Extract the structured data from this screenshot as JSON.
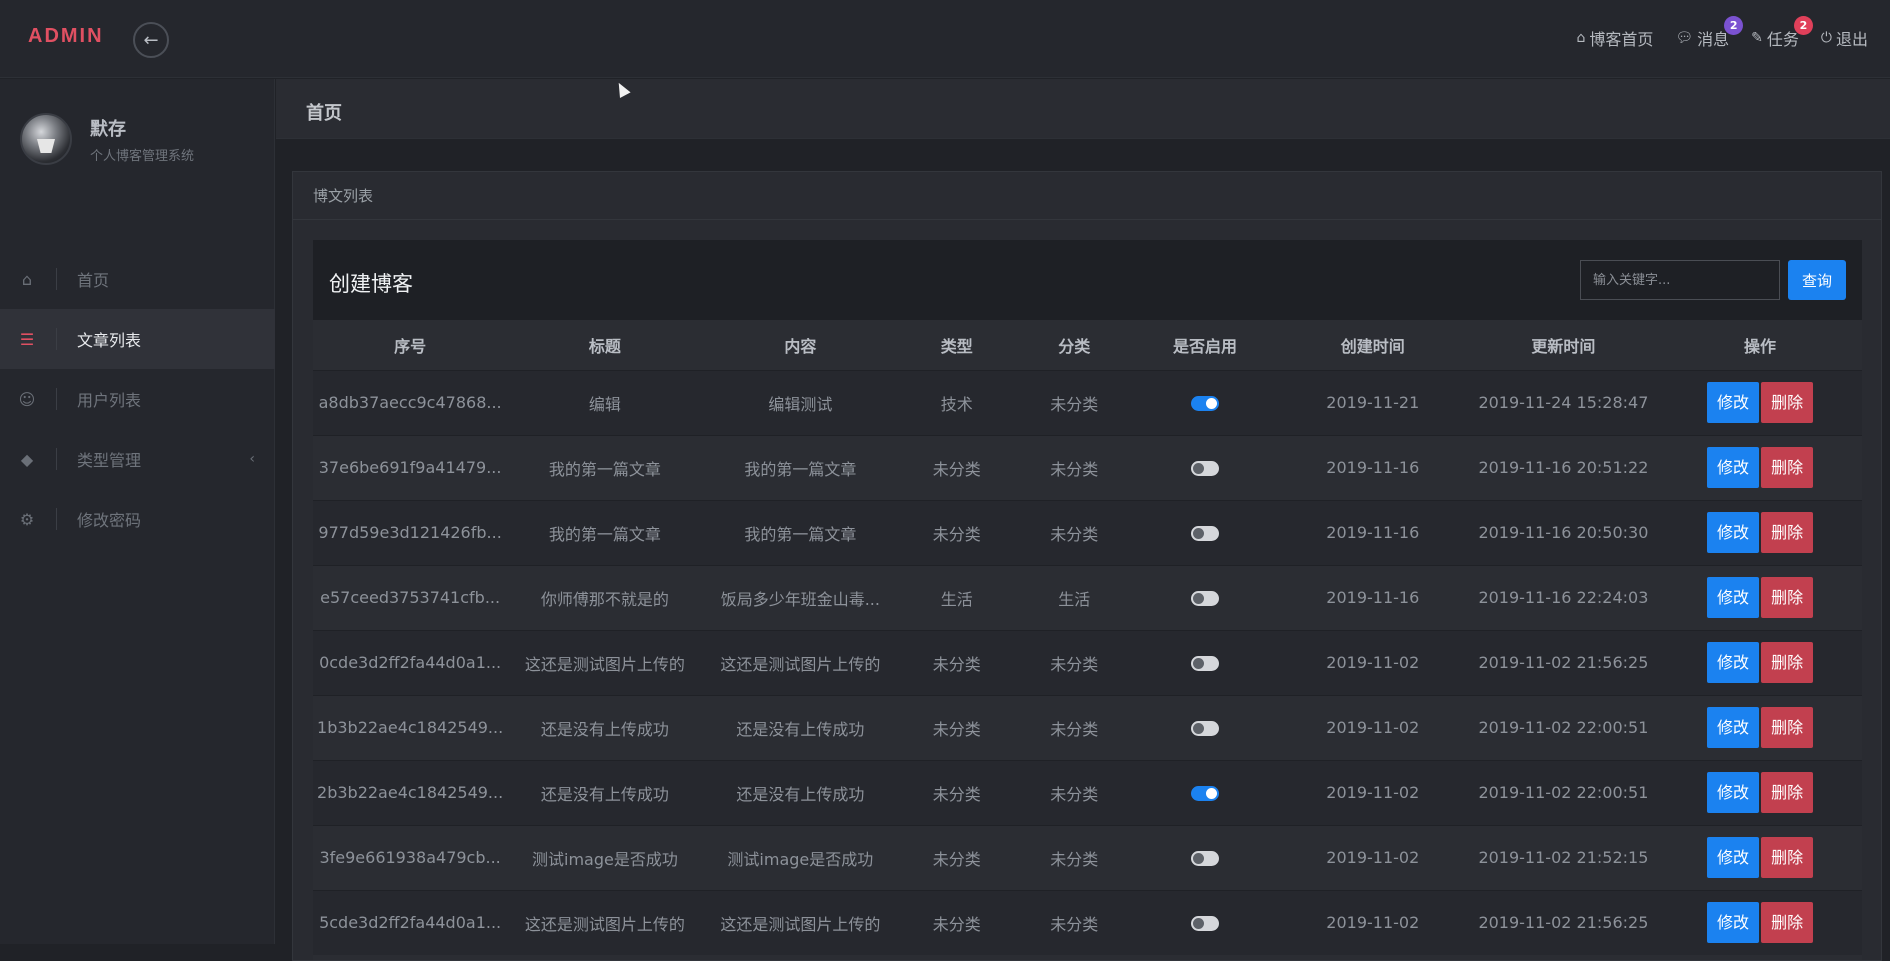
{
  "topbar": {
    "brand": "ADMIN",
    "collapse_icon": "arrow-left-icon",
    "nav": [
      {
        "icon": "home-icon",
        "label": "博客首页"
      },
      {
        "icon": "comment-icon",
        "label": "消息",
        "badge": "2",
        "badge_color": "#7b52d1"
      },
      {
        "icon": "edit-icon",
        "label": "任务",
        "badge": "2",
        "badge_color": "#e0405a"
      },
      {
        "icon": "power-icon",
        "label": "退出"
      }
    ]
  },
  "sidebar": {
    "profile": {
      "name": "默存",
      "subtitle": "个人博客管理系统"
    },
    "items": [
      {
        "icon": "home-icon",
        "label": "首页"
      },
      {
        "icon": "list-icon",
        "label": "文章列表",
        "active": true
      },
      {
        "icon": "users-icon",
        "label": "用户列表"
      },
      {
        "icon": "tags-icon",
        "label": "类型管理",
        "has_arrow": true
      },
      {
        "icon": "gear-icon",
        "label": "修改密码"
      }
    ]
  },
  "page": {
    "title": "首页",
    "card_title": "博文列表",
    "panel_title": "创建博客",
    "search_placeholder": "输入关键字...",
    "query_label": "查询"
  },
  "table": {
    "headers": [
      "序号",
      "标题",
      "内容",
      "类型",
      "分类",
      "是否启用",
      "创建时间",
      "更新时间",
      "操作"
    ],
    "edit_label": "修改",
    "delete_label": "删除",
    "rows": [
      {
        "id": "a8db37aecc9c47868...",
        "title": "编辑",
        "content": "编辑测试",
        "type": "技术",
        "category": "未分类",
        "enabled": true,
        "created": "2019-11-21",
        "updated": "2019-11-24 15:28:47"
      },
      {
        "id": "37e6be691f9a41479...",
        "title": "我的第一篇文章",
        "content": "我的第一篇文章",
        "type": "未分类",
        "category": "未分类",
        "enabled": false,
        "created": "2019-11-16",
        "updated": "2019-11-16 20:51:22"
      },
      {
        "id": "977d59e3d121426fb...",
        "title": "我的第一篇文章",
        "content": "我的第一篇文章",
        "type": "未分类",
        "category": "未分类",
        "enabled": false,
        "created": "2019-11-16",
        "updated": "2019-11-16 20:50:30"
      },
      {
        "id": "e57ceed3753741cfb...",
        "title": "你师傅那不就是的",
        "content": "饭局多少年班金山毒...",
        "type": "生活",
        "category": "生活",
        "enabled": false,
        "created": "2019-11-16",
        "updated": "2019-11-16 22:24:03"
      },
      {
        "id": "0cde3d2ff2fa44d0a1...",
        "title": "这还是测试图片上传的",
        "content": "这还是测试图片上传的",
        "type": "未分类",
        "category": "未分类",
        "enabled": false,
        "created": "2019-11-02",
        "updated": "2019-11-02 21:56:25"
      },
      {
        "id": "1b3b22ae4c1842549...",
        "title": "还是没有上传成功",
        "content": "还是没有上传成功",
        "type": "未分类",
        "category": "未分类",
        "enabled": false,
        "created": "2019-11-02",
        "updated": "2019-11-02 22:00:51"
      },
      {
        "id": "2b3b22ae4c1842549...",
        "title": "还是没有上传成功",
        "content": "还是没有上传成功",
        "type": "未分类",
        "category": "未分类",
        "enabled": true,
        "created": "2019-11-02",
        "updated": "2019-11-02 22:00:51"
      },
      {
        "id": "3fe9e661938a479cb...",
        "title": "测试image是否成功",
        "content": "测试image是否成功",
        "type": "未分类",
        "category": "未分类",
        "enabled": false,
        "created": "2019-11-02",
        "updated": "2019-11-02 21:52:15"
      },
      {
        "id": "5cde3d2ff2fa44d0a1...",
        "title": "这还是测试图片上传的",
        "content": "这还是测试图片上传的",
        "type": "未分类",
        "category": "未分类",
        "enabled": false,
        "created": "2019-11-02",
        "updated": "2019-11-02 21:56:25"
      }
    ]
  }
}
